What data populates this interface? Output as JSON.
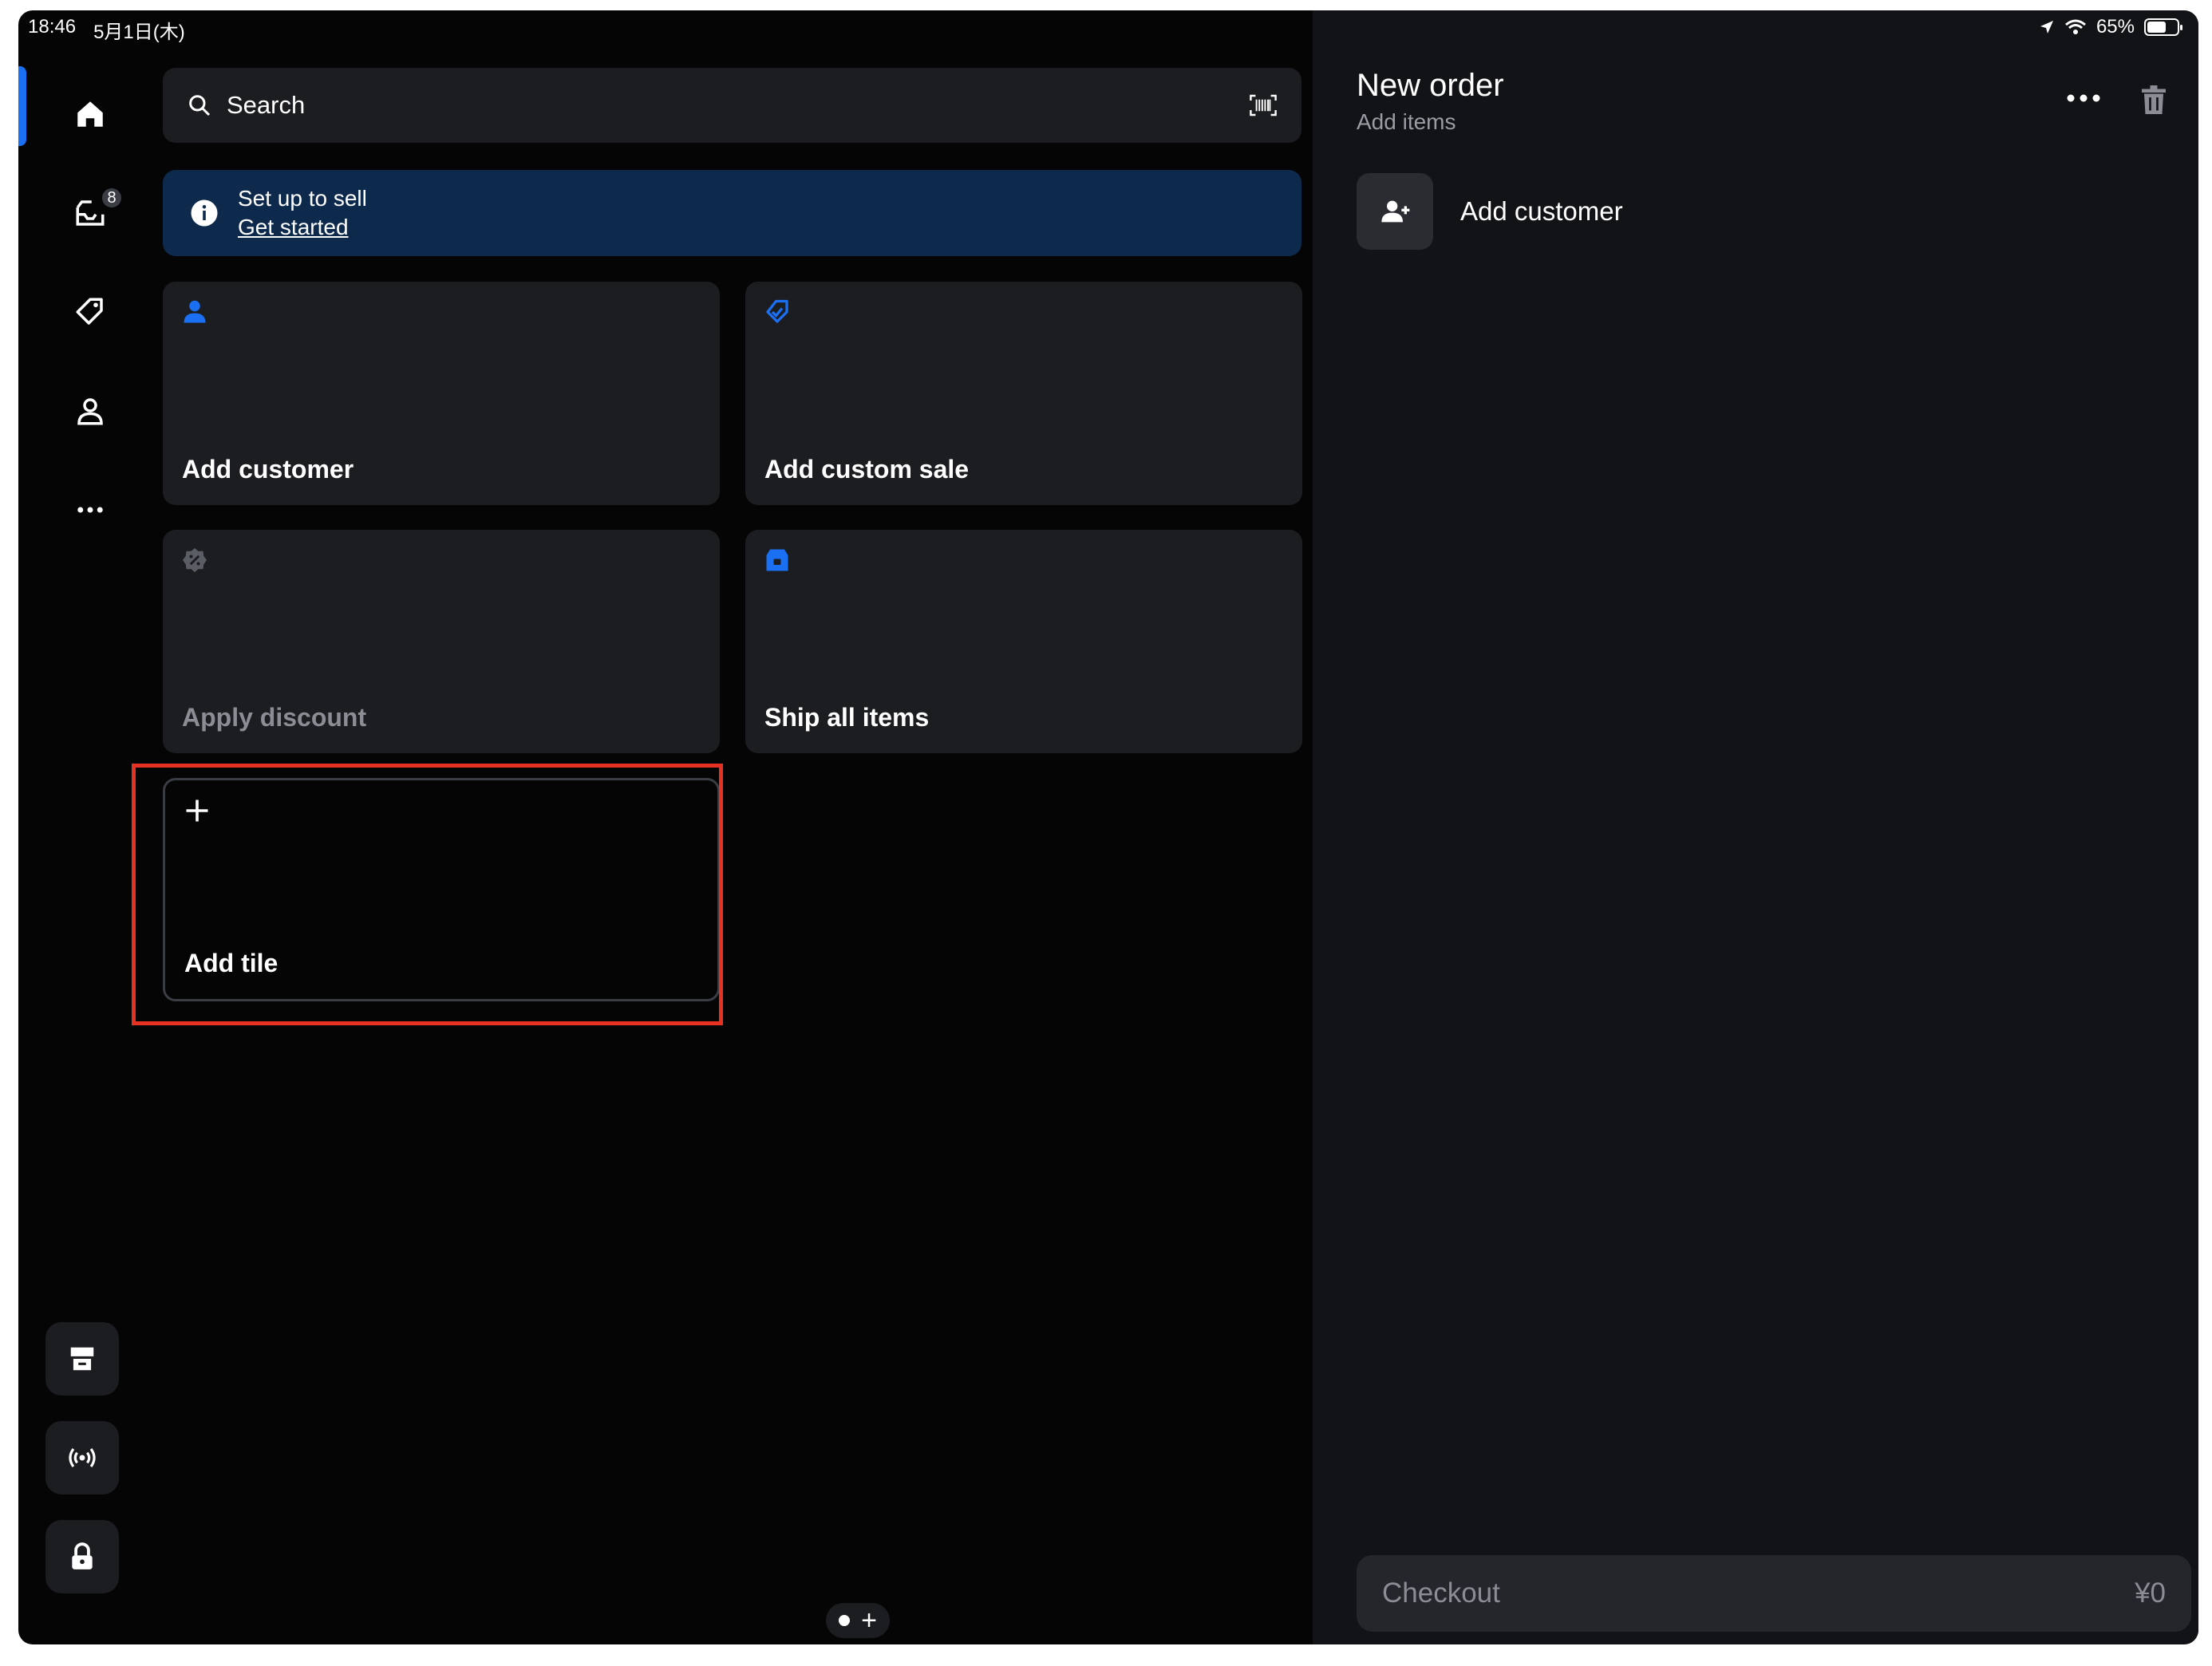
{
  "status_bar": {
    "time": "18:46",
    "date": "5月1日(木)",
    "battery": "65%",
    "battery_level": 0.65
  },
  "sidebar": {
    "items": [
      {
        "name": "home",
        "active": true
      },
      {
        "name": "inbox",
        "badge": "8"
      },
      {
        "name": "items"
      },
      {
        "name": "customers"
      },
      {
        "name": "more"
      }
    ],
    "bottom_items": [
      "store",
      "broadcast",
      "lock"
    ]
  },
  "search": {
    "placeholder": "Search"
  },
  "banner": {
    "title": "Set up to sell",
    "link": "Get started"
  },
  "tiles": [
    {
      "label": "Add customer",
      "icon": "person-icon",
      "enabled": true
    },
    {
      "label": "Add custom sale",
      "icon": "tag-check-icon",
      "enabled": true
    },
    {
      "label": "Apply discount",
      "icon": "discount-badge-icon",
      "enabled": false
    },
    {
      "label": "Ship all items",
      "icon": "shipping-box-icon",
      "enabled": true
    },
    {
      "label": "Add tile",
      "icon": "plus-icon",
      "enabled": true
    }
  ],
  "order": {
    "title": "New order",
    "subtitle": "Add items",
    "add_customer_label": "Add customer",
    "checkout_label": "Checkout",
    "checkout_total": "¥0"
  },
  "colors": {
    "accent": "#1a6ff2",
    "highlight": "#e53223",
    "banner": "#0d2a4d"
  }
}
